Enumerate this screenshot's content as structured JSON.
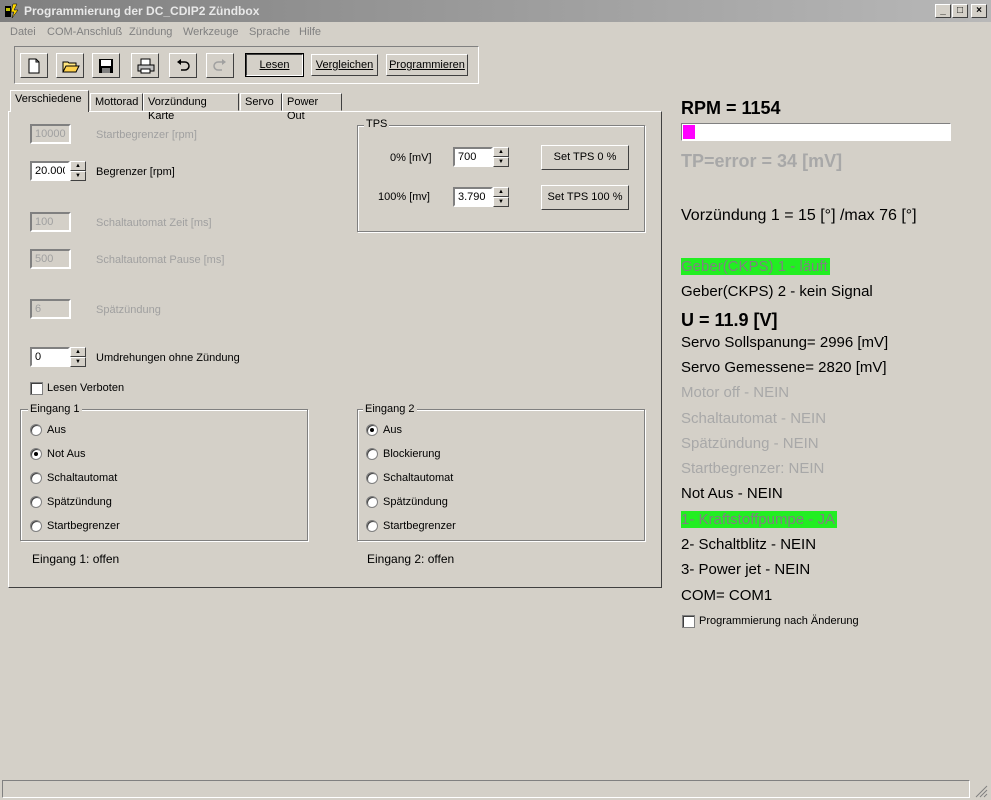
{
  "window": {
    "title": "Programmierung der DC_CDIP2 Zündbox",
    "minimize": "_",
    "maximize": "□",
    "close": "×"
  },
  "menu": [
    "Datei",
    "COM-Anschluß",
    "Zündung",
    "Werkzeuge",
    "Sprache",
    "Hilfe"
  ],
  "toolbar": {
    "icons": [
      "new-file-icon",
      "open-folder-icon",
      "save-icon",
      "print-icon",
      "undo-icon",
      "redo-icon"
    ],
    "lesen": "Lesen",
    "vergleichen": "Vergleichen",
    "programmieren": "Programmieren"
  },
  "tabs": [
    "Verschiedene",
    "Mottorad",
    "Vorzündung Karte",
    "Servo",
    "Power Out"
  ],
  "fields": {
    "startbegrenzer": {
      "value": "10000",
      "label": "Startbegrenzer [rpm]"
    },
    "begrenzer": {
      "value": "20.000",
      "label": "Begrenzer [rpm]"
    },
    "schalt_zeit": {
      "value": "100",
      "label": "Schaltautomat Zeit [ms]"
    },
    "schalt_pause": {
      "value": "500",
      "label": "Schaltautomat Pause [ms]"
    },
    "spaetzuendung": {
      "value": "6",
      "label": "Spätzündung"
    },
    "umdrehungen": {
      "value": "0",
      "label": "Umdrehungen ohne Zündung"
    },
    "lesen_verboten": "Lesen Verboten"
  },
  "tps": {
    "title": "TPS",
    "row0_label": "0%  [mV]",
    "row0_value": "700",
    "row0_button": "Set TPS 0 %",
    "row100_label": "100%  [mv]",
    "row100_value": "3.790",
    "row100_button": "Set TPS 100 %"
  },
  "eingang1": {
    "title": "Eingang 1",
    "options": [
      "Aus",
      "Not Aus",
      "Schaltautomat",
      "Spätzündung",
      "Startbegrenzer"
    ],
    "selected": 1,
    "status": "Eingang 1: offen"
  },
  "eingang2": {
    "title": "Eingang 2",
    "options": [
      "Aus",
      "Blockierung",
      "Schaltautomat",
      "Spätzündung",
      "Startbegrenzer"
    ],
    "selected": 0,
    "status": "Eingang 2: offen"
  },
  "status": {
    "rpm": "RPM = 1154",
    "rpm_bar_fraction": 0.045,
    "rpm_bar_color": "#ff00ff",
    "tp": "TP=error = 34 [mV]",
    "vorzuendung": "Vorzündung 1 = 15 [°] /max 76 [°]",
    "geber1": "Geber(CKPS) 1 - läuft",
    "geber2": "Geber(CKPS) 2 -  kein Signal",
    "voltage": "U = 11.9 [V]",
    "servo_soll": "Servo Sollspanung= 2996 [mV]",
    "servo_gem": "Servo Gemessene= 2820 [mV]",
    "motor_off": "Motor off - NEIN",
    "schaltautomat": "Schaltautomat - NEIN",
    "spaetzuendung": "Spätzündung - NEIN",
    "startbegrenzer": "Startbegrenzer: NEIN",
    "not_aus": "Not Aus - NEIN",
    "kraftstoff": "1- Kraftstoffpumpe - JA",
    "schaltblitz": "2- Schaltblitz - NEIN",
    "powerjet": "3- Power jet - NEIN",
    "com": "COM= COM1",
    "highlight_color": "#22ee22",
    "prog_nach_aenderung": "Programmierung nach Änderung"
  }
}
